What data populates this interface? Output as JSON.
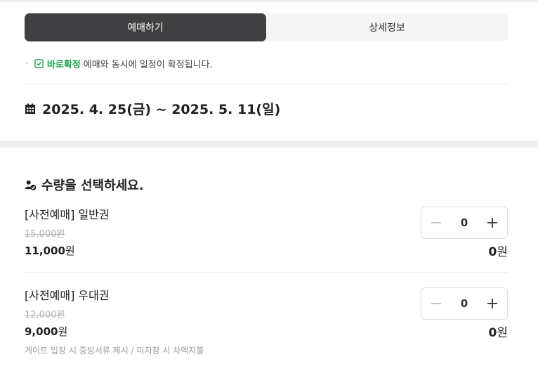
{
  "tabs": [
    {
      "label": "예매하기",
      "active": true
    },
    {
      "label": "상세정보",
      "active": false
    }
  ],
  "notice": {
    "bullet": "•",
    "highlight": "바로확정",
    "text": "예매와 동시에 일정이 확정됩니다."
  },
  "event_dates": "2025. 4. 25(금) ~ 2025. 5. 11(일)",
  "quantity_title": "수량을 선택하세요.",
  "tickets": [
    {
      "name": "[사전예매] 일반권",
      "original_price": "15,000원",
      "price_number": "11,000",
      "price_unit": "원",
      "quantity": "0",
      "subtotal_number": "0",
      "subtotal_unit": "원"
    },
    {
      "name": "[사전예매] 우대권",
      "original_price": "12,000원",
      "price_number": "9,000",
      "price_unit": "원",
      "note": "게이트 입장 시 증빙서류 제시 / 미지참 시 차액지불",
      "quantity": "0",
      "subtotal_number": "0",
      "subtotal_unit": "원"
    }
  ],
  "colors": {
    "active_tab": "#404042",
    "confirm_green": "#17a34a",
    "band_gray": "#eeeeef"
  },
  "icons": [
    "check-square-icon",
    "calendar-icon",
    "people-check-icon",
    "minus-icon",
    "plus-icon"
  ]
}
